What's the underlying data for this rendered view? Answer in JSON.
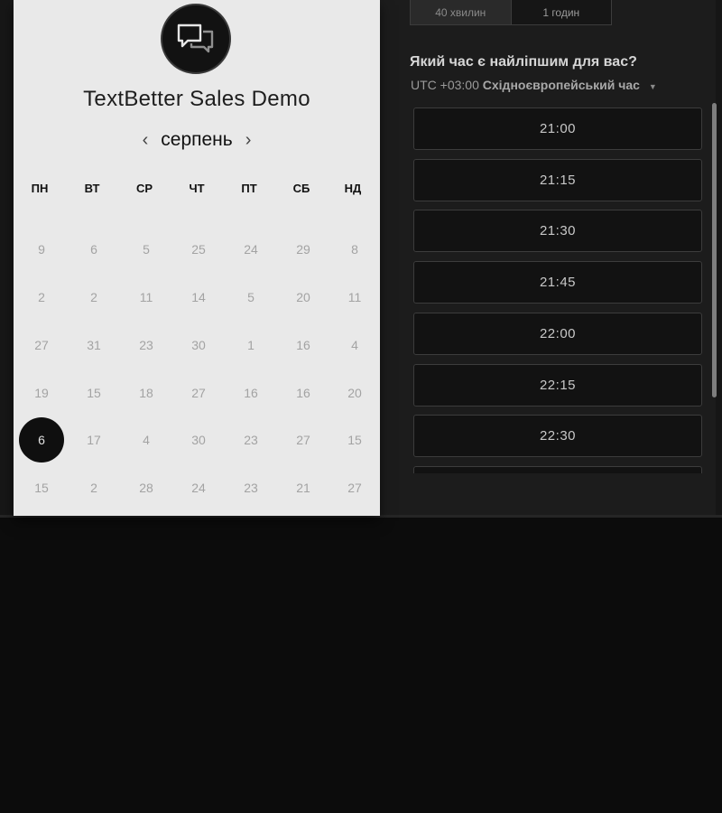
{
  "calendar": {
    "title": "TextBetter Sales Demo",
    "logo_icon": "chat-bubbles-icon",
    "month": "серпень",
    "prev_icon": "chevron-left-icon",
    "next_icon": "chevron-right-icon",
    "weekdays": [
      "ПН",
      "ВТ",
      "СР",
      "ЧТ",
      "ПТ",
      "СБ",
      "НД"
    ],
    "weeks": [
      [
        "9",
        "6",
        "5",
        "25",
        "24",
        "29",
        "8"
      ],
      [
        "2",
        "2",
        "11",
        "14",
        "5",
        "20",
        "11"
      ],
      [
        "27",
        "31",
        "23",
        "30",
        "1",
        "16",
        "4"
      ],
      [
        "19",
        "15",
        "18",
        "27",
        "16",
        "16",
        "20"
      ],
      [
        "6",
        "17",
        "4",
        "30",
        "23",
        "27",
        "15"
      ],
      [
        "15",
        "2",
        "28",
        "24",
        "23",
        "21",
        "27"
      ]
    ],
    "selected_day": "6"
  },
  "duration": {
    "options": [
      "40 хвилин",
      "1 годин"
    ]
  },
  "booking": {
    "question": "Який час є найліпшим для вас?",
    "timezone_offset": "UTC +03:00",
    "timezone_name": "Східноєвропейський час",
    "timezone_caret_icon": "caret-down-icon",
    "slots": [
      "21:00",
      "21:15",
      "21:30",
      "21:45",
      "22:00",
      "22:15",
      "22:30"
    ]
  },
  "colors": {
    "card_bg": "#e9e9e9",
    "panel_bg": "#1c1c1c",
    "selected_day_bg": "#0f0f0f",
    "slot_border": "#3c3c3c"
  }
}
